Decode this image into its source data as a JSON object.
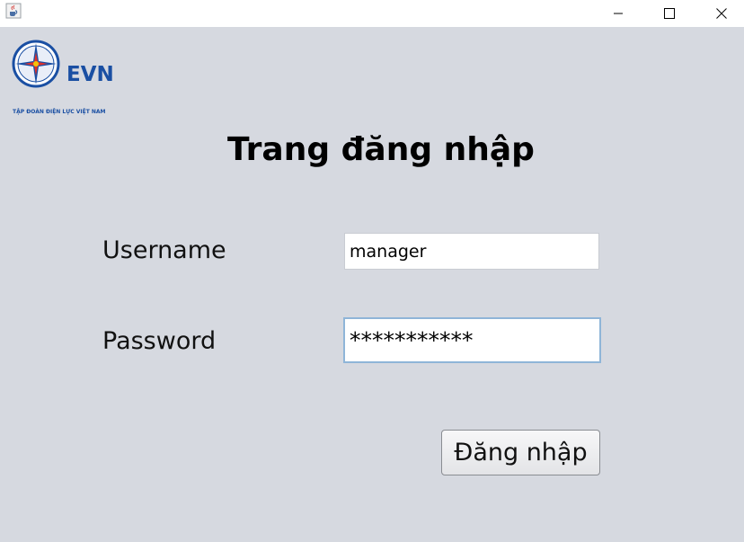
{
  "window": {
    "controls": [
      "minimize-icon",
      "maximize-icon",
      "close-icon"
    ]
  },
  "logo": {
    "brand": "EVN",
    "tagline": "TẬP ĐOÀN ĐIỆN LỰC VIỆT NAM",
    "colors": {
      "blue": "#1a4fa3",
      "red": "#e0302a",
      "yellow": "#f5c20a"
    }
  },
  "page": {
    "title": "Trang đăng nhập"
  },
  "form": {
    "username_label": "Username",
    "username_value": "manager",
    "password_label": "Password",
    "password_masked": "***********",
    "submit_label": "Đăng nhập"
  },
  "colors": {
    "background": "#d6d9e0",
    "focus_border": "#8fb5d8"
  }
}
